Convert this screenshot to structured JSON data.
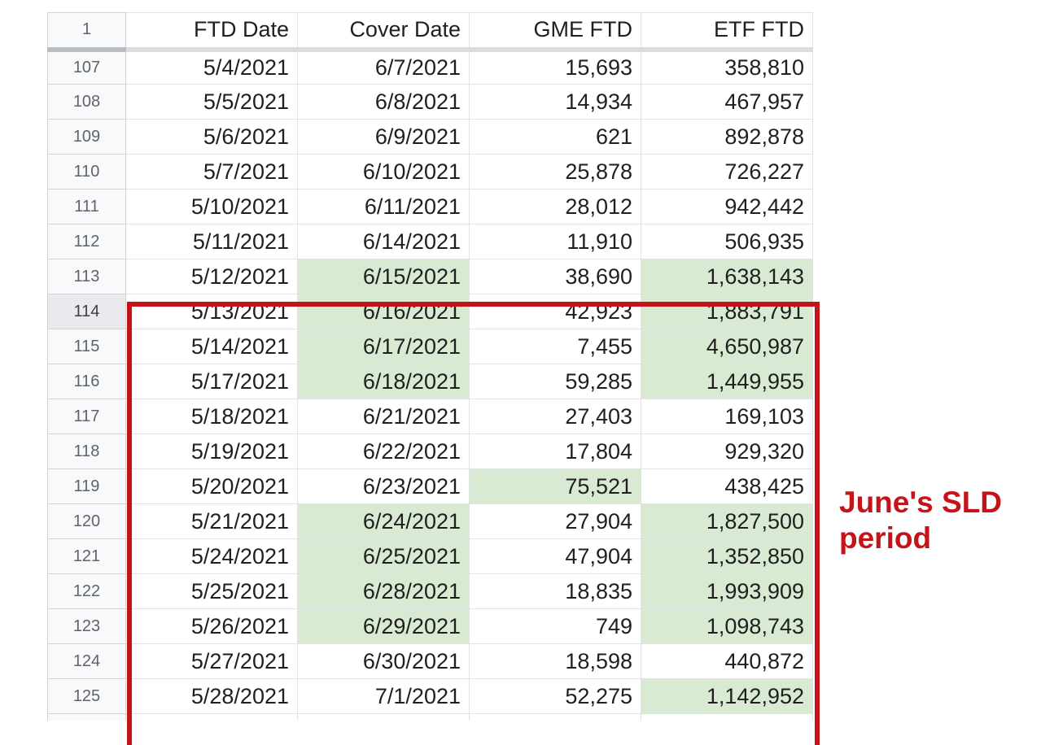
{
  "sheet": {
    "header_row_number": "1",
    "columns": [
      "FTD Date",
      "Cover Date",
      "GME FTD",
      "ETF FTD"
    ],
    "rows": [
      {
        "num": "107",
        "cells": [
          "5/4/2021",
          "6/7/2021",
          "15,693",
          "358,810"
        ],
        "highlight": [
          false,
          false,
          false,
          false
        ]
      },
      {
        "num": "108",
        "cells": [
          "5/5/2021",
          "6/8/2021",
          "14,934",
          "467,957"
        ],
        "highlight": [
          false,
          false,
          false,
          false
        ]
      },
      {
        "num": "109",
        "cells": [
          "5/6/2021",
          "6/9/2021",
          "621",
          "892,878"
        ],
        "highlight": [
          false,
          false,
          false,
          false
        ]
      },
      {
        "num": "110",
        "cells": [
          "5/7/2021",
          "6/10/2021",
          "25,878",
          "726,227"
        ],
        "highlight": [
          false,
          false,
          false,
          false
        ]
      },
      {
        "num": "111",
        "cells": [
          "5/10/2021",
          "6/11/2021",
          "28,012",
          "942,442"
        ],
        "highlight": [
          false,
          false,
          false,
          false
        ]
      },
      {
        "num": "112",
        "cells": [
          "5/11/2021",
          "6/14/2021",
          "11,910",
          "506,935"
        ],
        "highlight": [
          false,
          false,
          false,
          false
        ]
      },
      {
        "num": "113",
        "cells": [
          "5/12/2021",
          "6/15/2021",
          "38,690",
          "1,638,143"
        ],
        "highlight": [
          false,
          true,
          false,
          true
        ]
      },
      {
        "num": "114",
        "cells": [
          "5/13/2021",
          "6/16/2021",
          "42,923",
          "1,883,791"
        ],
        "highlight": [
          false,
          true,
          false,
          true
        ],
        "active": true
      },
      {
        "num": "115",
        "cells": [
          "5/14/2021",
          "6/17/2021",
          "7,455",
          "4,650,987"
        ],
        "highlight": [
          false,
          true,
          false,
          true
        ]
      },
      {
        "num": "116",
        "cells": [
          "5/17/2021",
          "6/18/2021",
          "59,285",
          "1,449,955"
        ],
        "highlight": [
          false,
          true,
          false,
          true
        ]
      },
      {
        "num": "117",
        "cells": [
          "5/18/2021",
          "6/21/2021",
          "27,403",
          "169,103"
        ],
        "highlight": [
          false,
          false,
          false,
          false
        ]
      },
      {
        "num": "118",
        "cells": [
          "5/19/2021",
          "6/22/2021",
          "17,804",
          "929,320"
        ],
        "highlight": [
          false,
          false,
          false,
          false
        ]
      },
      {
        "num": "119",
        "cells": [
          "5/20/2021",
          "6/23/2021",
          "75,521",
          "438,425"
        ],
        "highlight": [
          false,
          false,
          true,
          false
        ]
      },
      {
        "num": "120",
        "cells": [
          "5/21/2021",
          "6/24/2021",
          "27,904",
          "1,827,500"
        ],
        "highlight": [
          false,
          true,
          false,
          true
        ]
      },
      {
        "num": "121",
        "cells": [
          "5/24/2021",
          "6/25/2021",
          "47,904",
          "1,352,850"
        ],
        "highlight": [
          false,
          true,
          false,
          true
        ]
      },
      {
        "num": "122",
        "cells": [
          "5/25/2021",
          "6/28/2021",
          "18,835",
          "1,993,909"
        ],
        "highlight": [
          false,
          true,
          false,
          true
        ]
      },
      {
        "num": "123",
        "cells": [
          "5/26/2021",
          "6/29/2021",
          "749",
          "1,098,743"
        ],
        "highlight": [
          false,
          true,
          false,
          true
        ]
      },
      {
        "num": "124",
        "cells": [
          "5/27/2021",
          "6/30/2021",
          "18,598",
          "440,872"
        ],
        "highlight": [
          false,
          false,
          false,
          false
        ]
      },
      {
        "num": "125",
        "cells": [
          "5/28/2021",
          "7/1/2021",
          "52,275",
          "1,142,952"
        ],
        "highlight": [
          false,
          false,
          false,
          true
        ]
      }
    ]
  },
  "annotation": {
    "line1": "June's SLD",
    "line2": "period"
  },
  "colors": {
    "highlight_fill": "#d9ead3",
    "annotation_red": "#c4141a",
    "gridline": "#e2e2e2",
    "row_header_bg": "#f8f9fa"
  }
}
